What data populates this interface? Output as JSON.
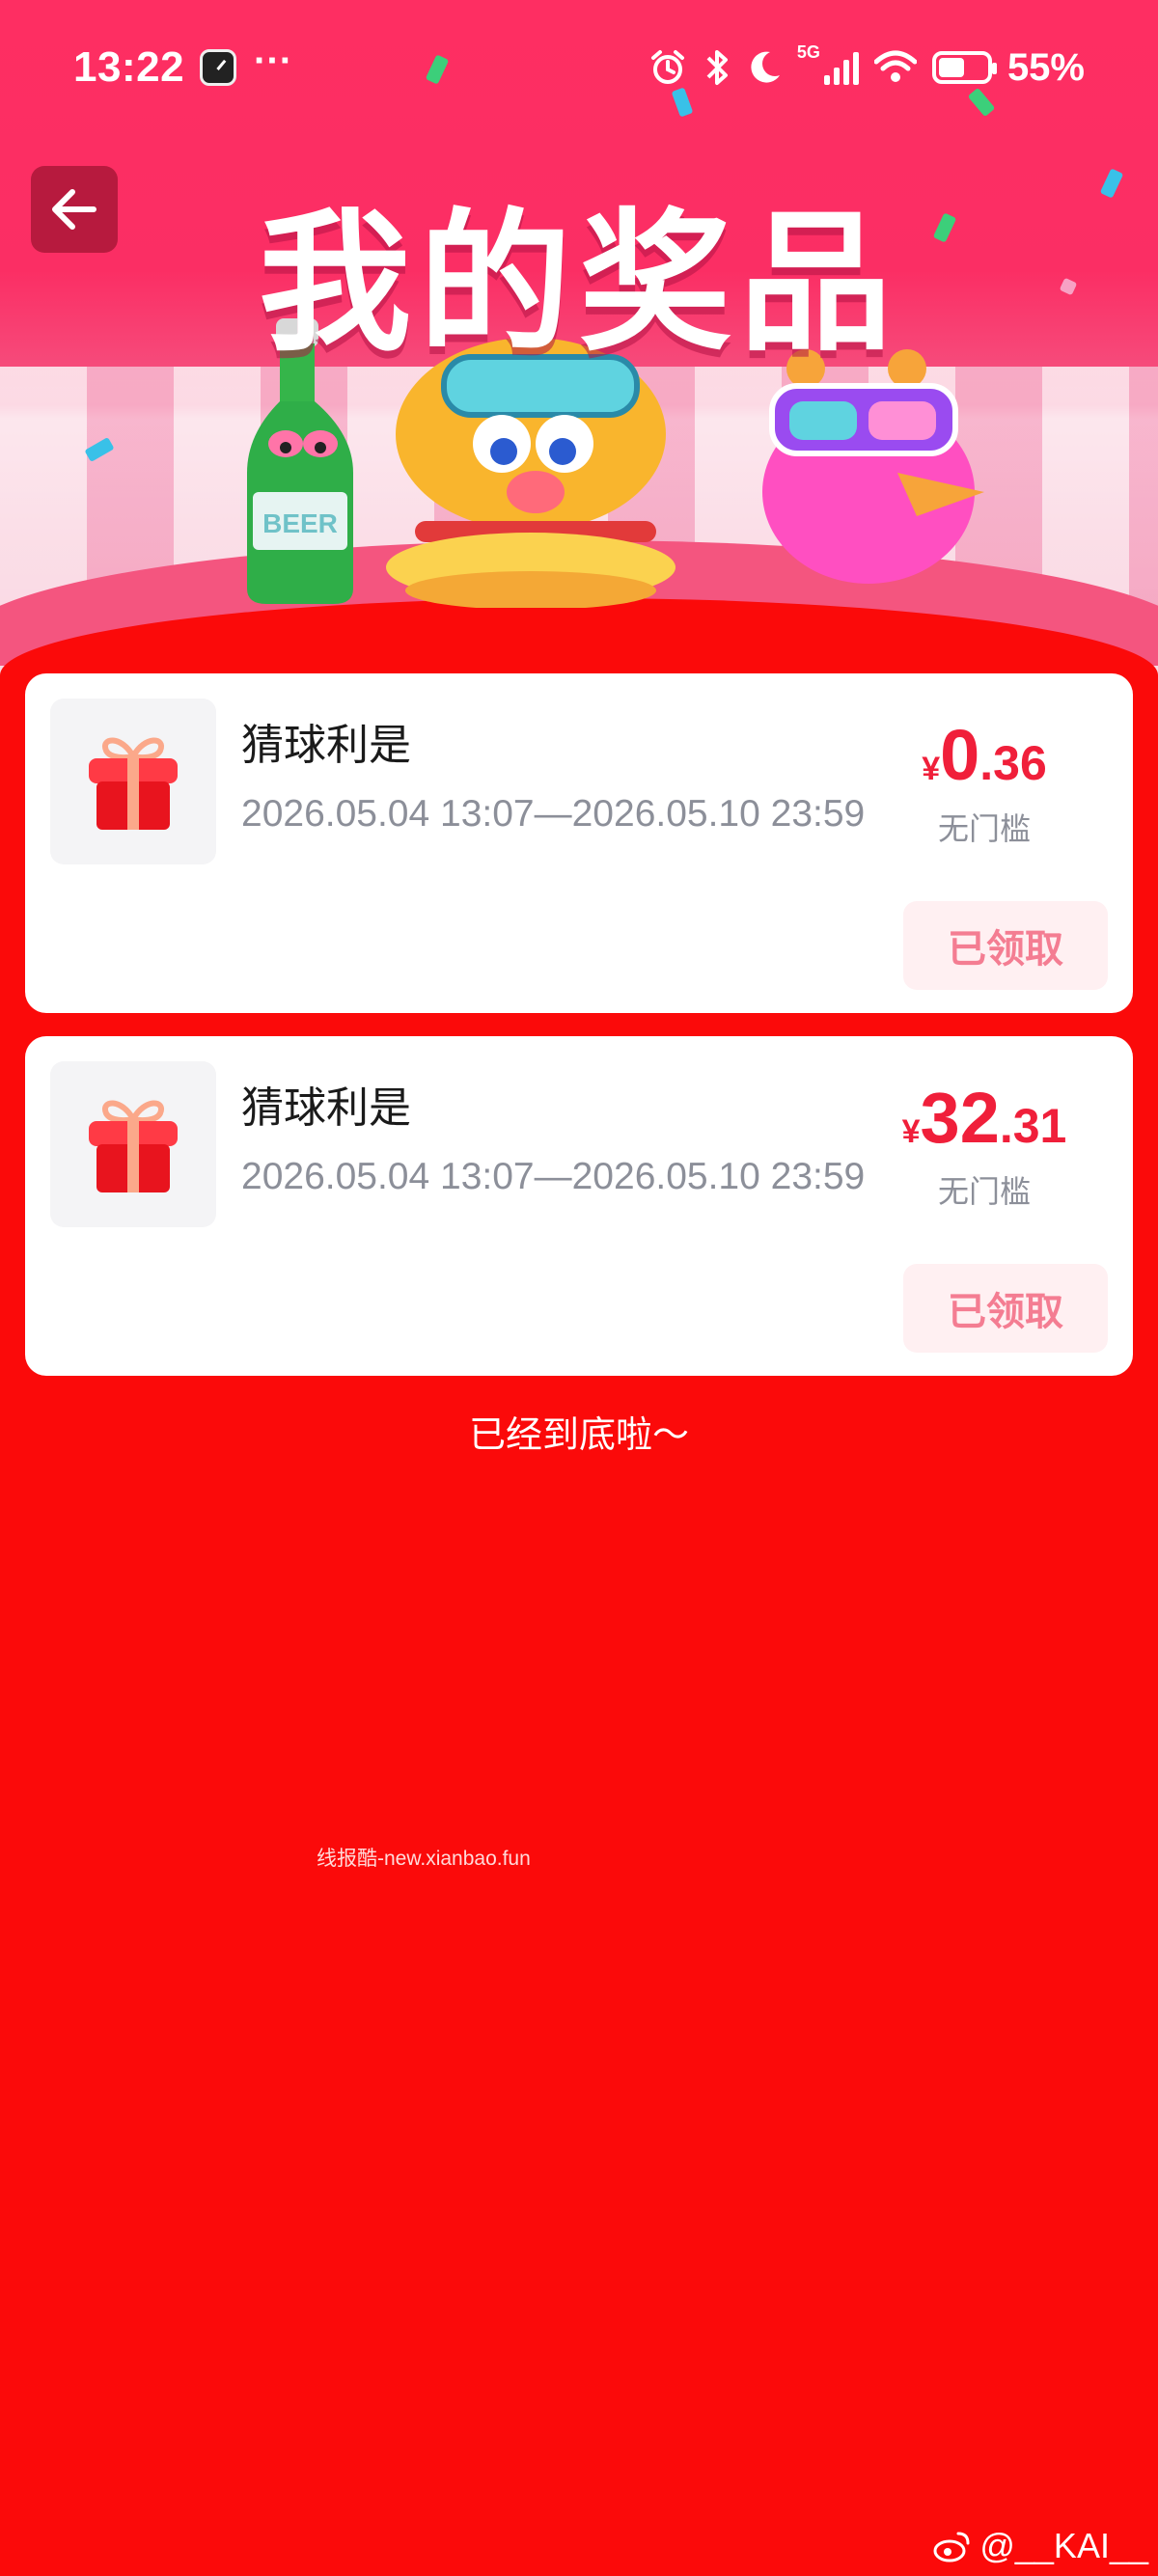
{
  "status_bar": {
    "time": "13:22",
    "more": "···",
    "network": "5G",
    "battery_level": 0.55,
    "battery_text": "55%"
  },
  "header": {
    "title": "我的奖品",
    "back_icon": "arrow-left-icon"
  },
  "prizes": [
    {
      "name": "猜球利是",
      "period": "2026.05.04 13:07—2026.05.10 23:59",
      "currency": "¥",
      "amount_int": "0",
      "amount_dec": ".36",
      "threshold": "无门槛",
      "button": "已领取",
      "icon": "gift-icon"
    },
    {
      "name": "猜球利是",
      "period": "2026.05.04 13:07—2026.05.10 23:59",
      "currency": "¥",
      "amount_int": "32",
      "amount_dec": ".31",
      "threshold": "无门槛",
      "button": "已领取",
      "icon": "gift-icon"
    }
  ],
  "end_text": "已经到底啦～",
  "watermark": "线报酷-new.xianbao.fun",
  "credit": "@__KAI__",
  "colors": {
    "page_bg": "#fb0a0a",
    "amount": "#f01f3a",
    "claimed_button_text": "#f47d92",
    "claimed_button_bg": "#fff0f2"
  }
}
